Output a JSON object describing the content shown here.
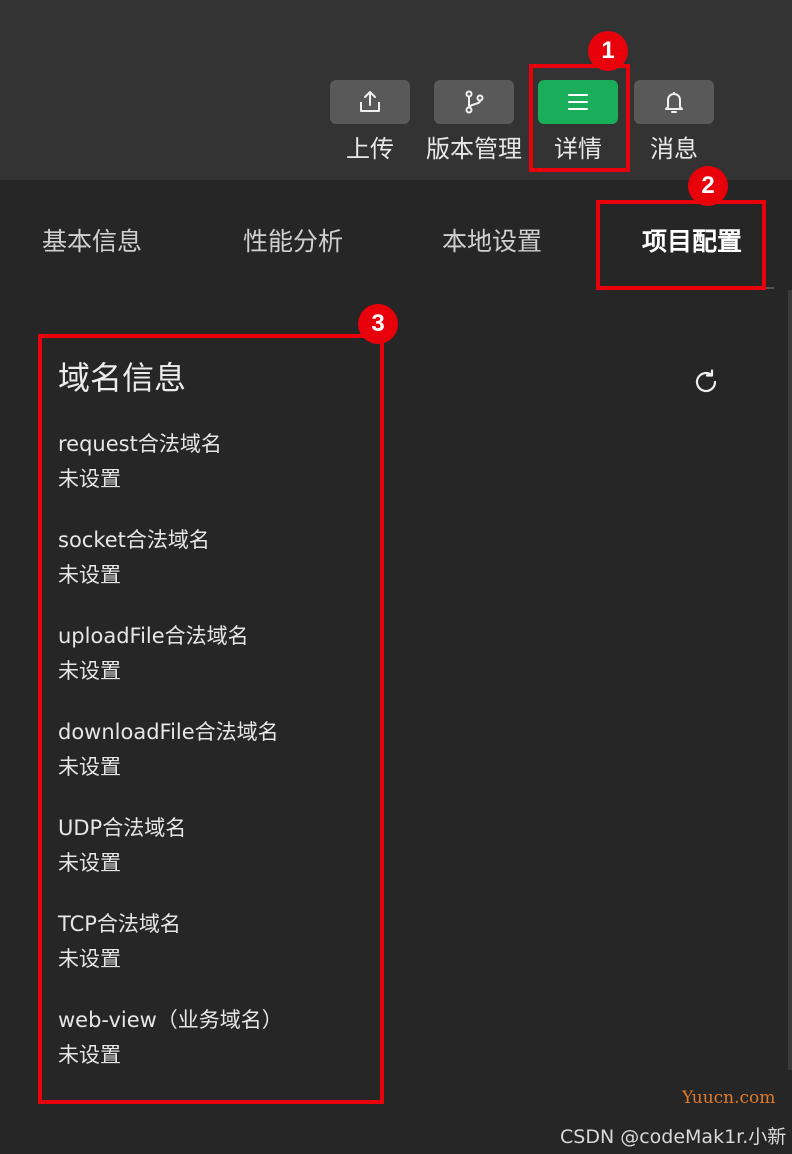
{
  "toolbar": {
    "buttons": [
      {
        "label": "上传",
        "icon": "upload-icon",
        "active": false
      },
      {
        "label": "版本管理",
        "icon": "branch-icon",
        "active": false
      },
      {
        "label": "详情",
        "icon": "menu-icon",
        "active": true
      },
      {
        "label": "消息",
        "icon": "bell-icon",
        "active": false
      }
    ]
  },
  "tabs": [
    {
      "label": "基本信息",
      "active": false
    },
    {
      "label": "性能分析",
      "active": false
    },
    {
      "label": "本地设置",
      "active": false
    },
    {
      "label": "项目配置",
      "active": true
    }
  ],
  "domain_section": {
    "title": "域名信息",
    "refresh_icon": "refresh-icon",
    "items": [
      {
        "name": "request合法域名",
        "value": "未设置"
      },
      {
        "name": "socket合法域名",
        "value": "未设置"
      },
      {
        "name": "uploadFile合法域名",
        "value": "未设置"
      },
      {
        "name": "downloadFile合法域名",
        "value": "未设置"
      },
      {
        "name": "UDP合法域名",
        "value": "未设置"
      },
      {
        "name": "TCP合法域名",
        "value": "未设置"
      },
      {
        "name": "web-view（业务域名）",
        "value": "未设置"
      }
    ]
  },
  "annotations": {
    "markers": [
      "1",
      "2",
      "3"
    ],
    "color": "#e8000b"
  },
  "colors": {
    "accent": "#1aad5a",
    "topbar_bg": "#333333",
    "page_bg": "#262626"
  },
  "watermarks": {
    "site": "Yuucn.com",
    "author": "CSDN @codeMak1r.小新"
  }
}
